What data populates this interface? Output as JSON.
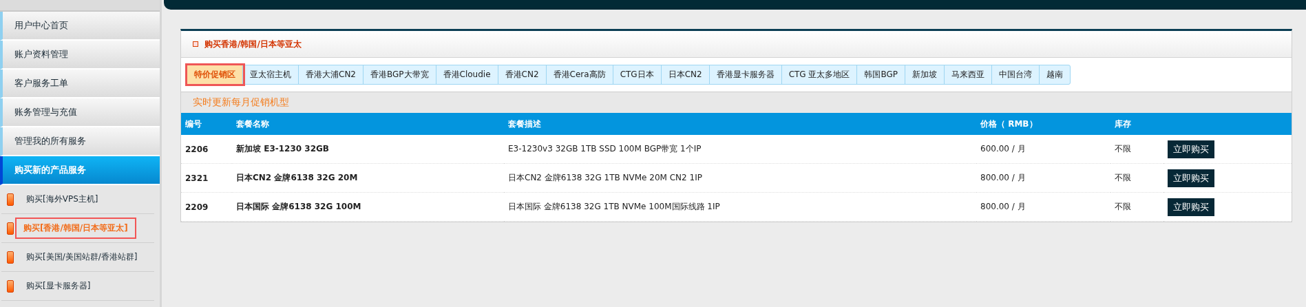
{
  "sidebar": {
    "items": [
      {
        "label": "用户中心首页",
        "selected": false
      },
      {
        "label": "账户资料管理",
        "selected": false
      },
      {
        "label": "客户服务工单",
        "selected": false
      },
      {
        "label": "账务管理与充值",
        "selected": false
      },
      {
        "label": "管理我的所有服务",
        "selected": false
      },
      {
        "label": "购买新的产品服务",
        "selected": true
      }
    ],
    "sub_items": [
      {
        "label": "购买[海外VPS主机]",
        "selected": false
      },
      {
        "label": "购买[香港/韩国/日本等亚太]",
        "selected": true
      },
      {
        "label": "购买[美国/美国站群/香港站群]",
        "selected": false
      },
      {
        "label": "购买[显卡服务器]",
        "selected": false
      }
    ]
  },
  "panel": {
    "title": "购买香港/韩国/日本等亚太",
    "tabs": [
      {
        "label": "特价促销区",
        "selected": true
      },
      {
        "label": "亚太宿主机",
        "selected": false
      },
      {
        "label": "香港大浦CN2",
        "selected": false
      },
      {
        "label": "香港BGP大带宽",
        "selected": false
      },
      {
        "label": "香港Cloudie",
        "selected": false
      },
      {
        "label": "香港CN2",
        "selected": false
      },
      {
        "label": "香港Cera高防",
        "selected": false
      },
      {
        "label": "CTG日本",
        "selected": false
      },
      {
        "label": "日本CN2",
        "selected": false
      },
      {
        "label": "香港显卡服务器",
        "selected": false
      },
      {
        "label": "CTG 亚太多地区",
        "selected": false
      },
      {
        "label": "韩国BGP",
        "selected": false
      },
      {
        "label": "新加坡",
        "selected": false
      },
      {
        "label": "马来西亚",
        "selected": false
      },
      {
        "label": "中国台湾",
        "selected": false
      },
      {
        "label": "越南",
        "selected": false
      }
    ],
    "notice": "实时更新每月促销机型",
    "table": {
      "columns": [
        "编号",
        "套餐名称",
        "套餐描述",
        "价格（ RMB）",
        "库存"
      ],
      "rows": [
        {
          "id": "2206",
          "name": "新加坡 E3-1230 32GB",
          "description": "E3-1230v3 32GB 1TB SSD 100M BGP带宽 1个IP",
          "price": "600.00 / 月",
          "stock": "不限",
          "action": "立即购买"
        },
        {
          "id": "2321",
          "name": "日本CN2 金牌6138 32G 20M",
          "description": "日本CN2 金牌6138 32G 1TB NVMe 20M CN2 1IP",
          "price": "800.00 / 月",
          "stock": "不限",
          "action": "立即购买"
        },
        {
          "id": "2209",
          "name": "日本国际 金牌6138 32G 100M",
          "description": "日本国际 金牌6138 32G 1TB NVMe 100M国际线路 1IP",
          "price": "800.00 / 月",
          "stock": "不限",
          "action": "立即购买"
        }
      ]
    }
  }
}
